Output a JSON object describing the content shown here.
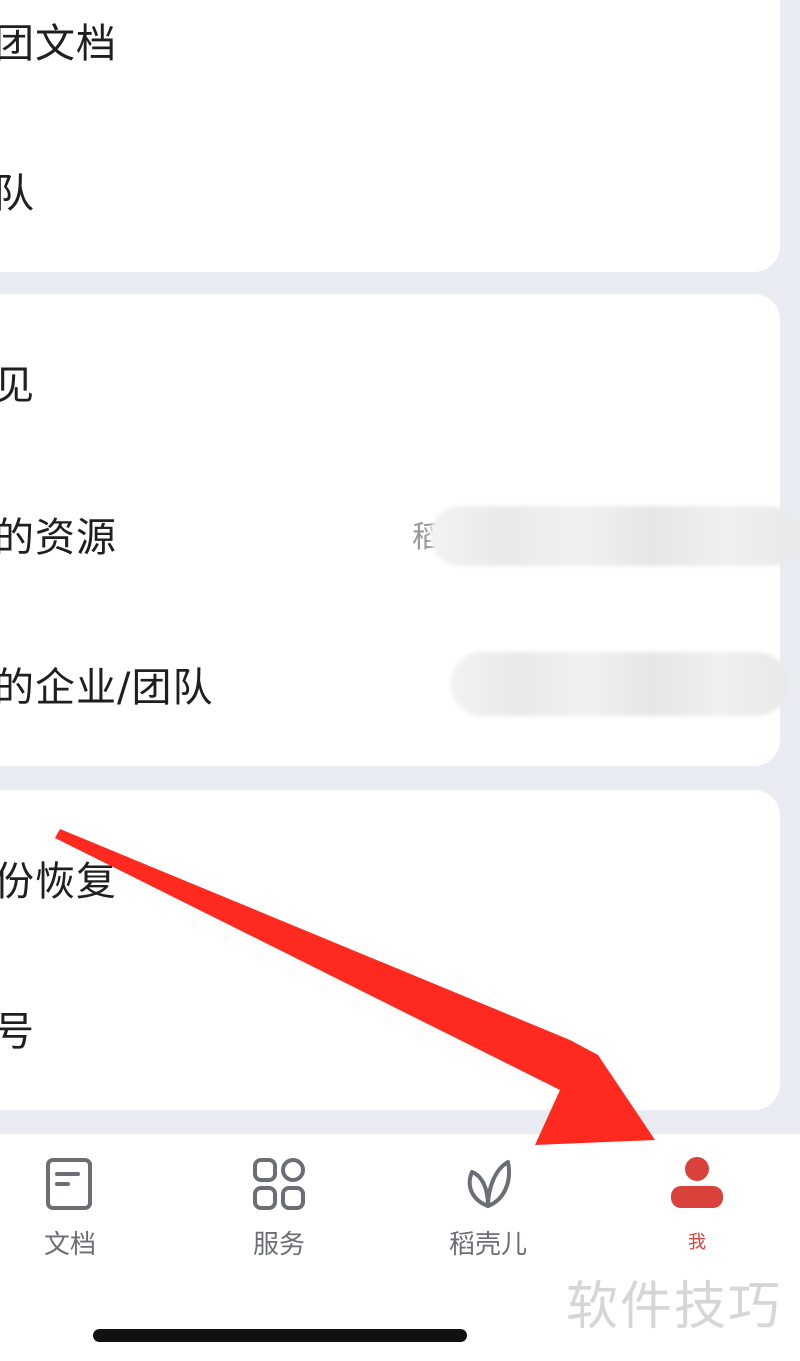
{
  "cards": [
    {
      "rows": [
        {
          "label": "团文档"
        },
        {
          "label": "队"
        }
      ]
    },
    {
      "rows": [
        {
          "label": "见"
        },
        {
          "label": "的资源",
          "value": "稻"
        },
        {
          "label": "的企业/团队"
        }
      ]
    },
    {
      "rows": [
        {
          "label": "份恢复"
        },
        {
          "label": "号"
        }
      ]
    }
  ],
  "tabbar": {
    "tabs": [
      {
        "label": "文档",
        "icon": "document-icon"
      },
      {
        "label": "服务",
        "icon": "grid-icon"
      },
      {
        "label": "稻壳儿",
        "icon": "leaf-icon"
      },
      {
        "label": "我",
        "icon": "user-icon",
        "active": true
      }
    ]
  },
  "colors": {
    "accent": "#d9423a",
    "annotation_arrow": "#ff2a1f",
    "background": "#e9ecf3"
  },
  "watermark": "软件技巧"
}
